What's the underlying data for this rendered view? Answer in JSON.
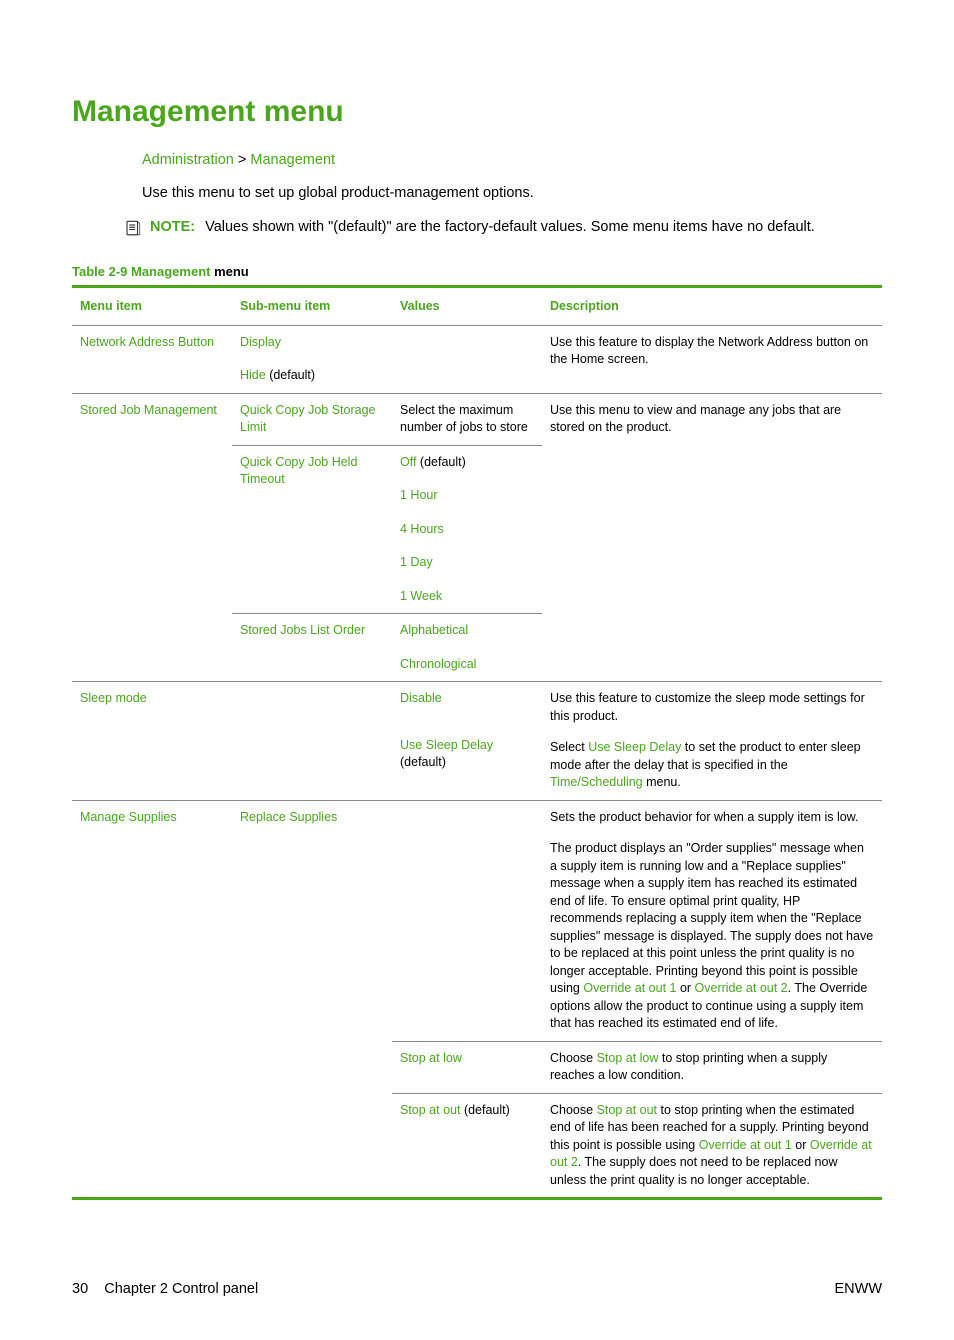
{
  "title": "Management menu",
  "breadcrumb": {
    "a": "Administration",
    "sep": ">",
    "b": "Management"
  },
  "intro": "Use this menu to set up global product-management options.",
  "note": {
    "label": "NOTE:",
    "text": "Values shown with \"(default)\" are the factory-default values. Some menu items have no default."
  },
  "tableCaption": {
    "left": "Table 2-9",
    "mid": "  Management ",
    "right": "menu"
  },
  "headers": {
    "c1": "Menu item",
    "c2": "Sub-menu item",
    "c3": "Values",
    "c4": "Description"
  },
  "rows": {
    "r1": {
      "menu": "Network Address Button",
      "sub1": "Display",
      "sub2a": "Hide",
      "sub2b": " (default)",
      "desc": "Use this feature to display the Network Address button on the Home screen."
    },
    "r2": {
      "menu": "Stored Job Management",
      "sub1": "Quick Copy Job Storage Limit",
      "val1": "Select the maximum number of jobs to store",
      "desc": "Use this menu to view and manage any jobs that are stored on the product.",
      "sub2": "Quick Copy Job Held Timeout",
      "v2a": "Off",
      "v2b": " (default)",
      "v3": "1 Hour",
      "v4": "4 Hours",
      "v5": "1 Day",
      "v6": "1 Week",
      "sub3": "Stored Jobs List Order",
      "v7": "Alphabetical",
      "v8": "Chronological"
    },
    "r3": {
      "menu": "Sleep mode",
      "v1": "Disable",
      "v2a": "Use Sleep Delay",
      "v2b": " (default)",
      "d1": "Use this feature to customize the sleep mode settings for this product.",
      "d2a": "Select ",
      "d2b": "Use Sleep Delay",
      "d2c": " to set the product to enter sleep mode after the delay that is specified in the ",
      "d2d": "Time/Scheduling",
      "d2e": " menu."
    },
    "r4": {
      "menu": "Manage Supplies",
      "sub1": "Replace Supplies",
      "d1": "Sets the product behavior for when a supply item is low.",
      "d2a": "The product displays an \"Order supplies\" message when a supply item is running low and a \"Replace supplies\" message when a supply item has reached its estimated end of life. To ensure optimal print quality, HP recommends replacing a supply item when the \"Replace supplies\" message is displayed. The supply does not have to be replaced at this point unless the print quality is no longer acceptable. Printing beyond this point is possible using ",
      "d2b": "Override at out 1",
      "d2c": " or ",
      "d2d": "Override at out 2",
      "d2e": ". The Override options allow the product to continue using a supply item that has reached its estimated end of life.",
      "v2a": "Stop at low",
      "e2a": "Choose ",
      "e2b": "Stop at low",
      "e2c": " to stop printing when a supply reaches a low condition.",
      "v3a": "Stop at out",
      "v3b": " (default)",
      "f2a": "Choose ",
      "f2b": "Stop at out",
      "f2c": " to stop printing when the estimated end of life has been reached for a supply. Printing beyond this point is possible using ",
      "f2d": "Override at out 1",
      "f2e": " or ",
      "f2f": "Override at out 2",
      "f2g": ". The supply does not need to be replaced now unless the print quality is no longer acceptable."
    }
  },
  "footer": {
    "left1": "30",
    "left2": "Chapter 2   Control panel",
    "right": "ENWW"
  }
}
